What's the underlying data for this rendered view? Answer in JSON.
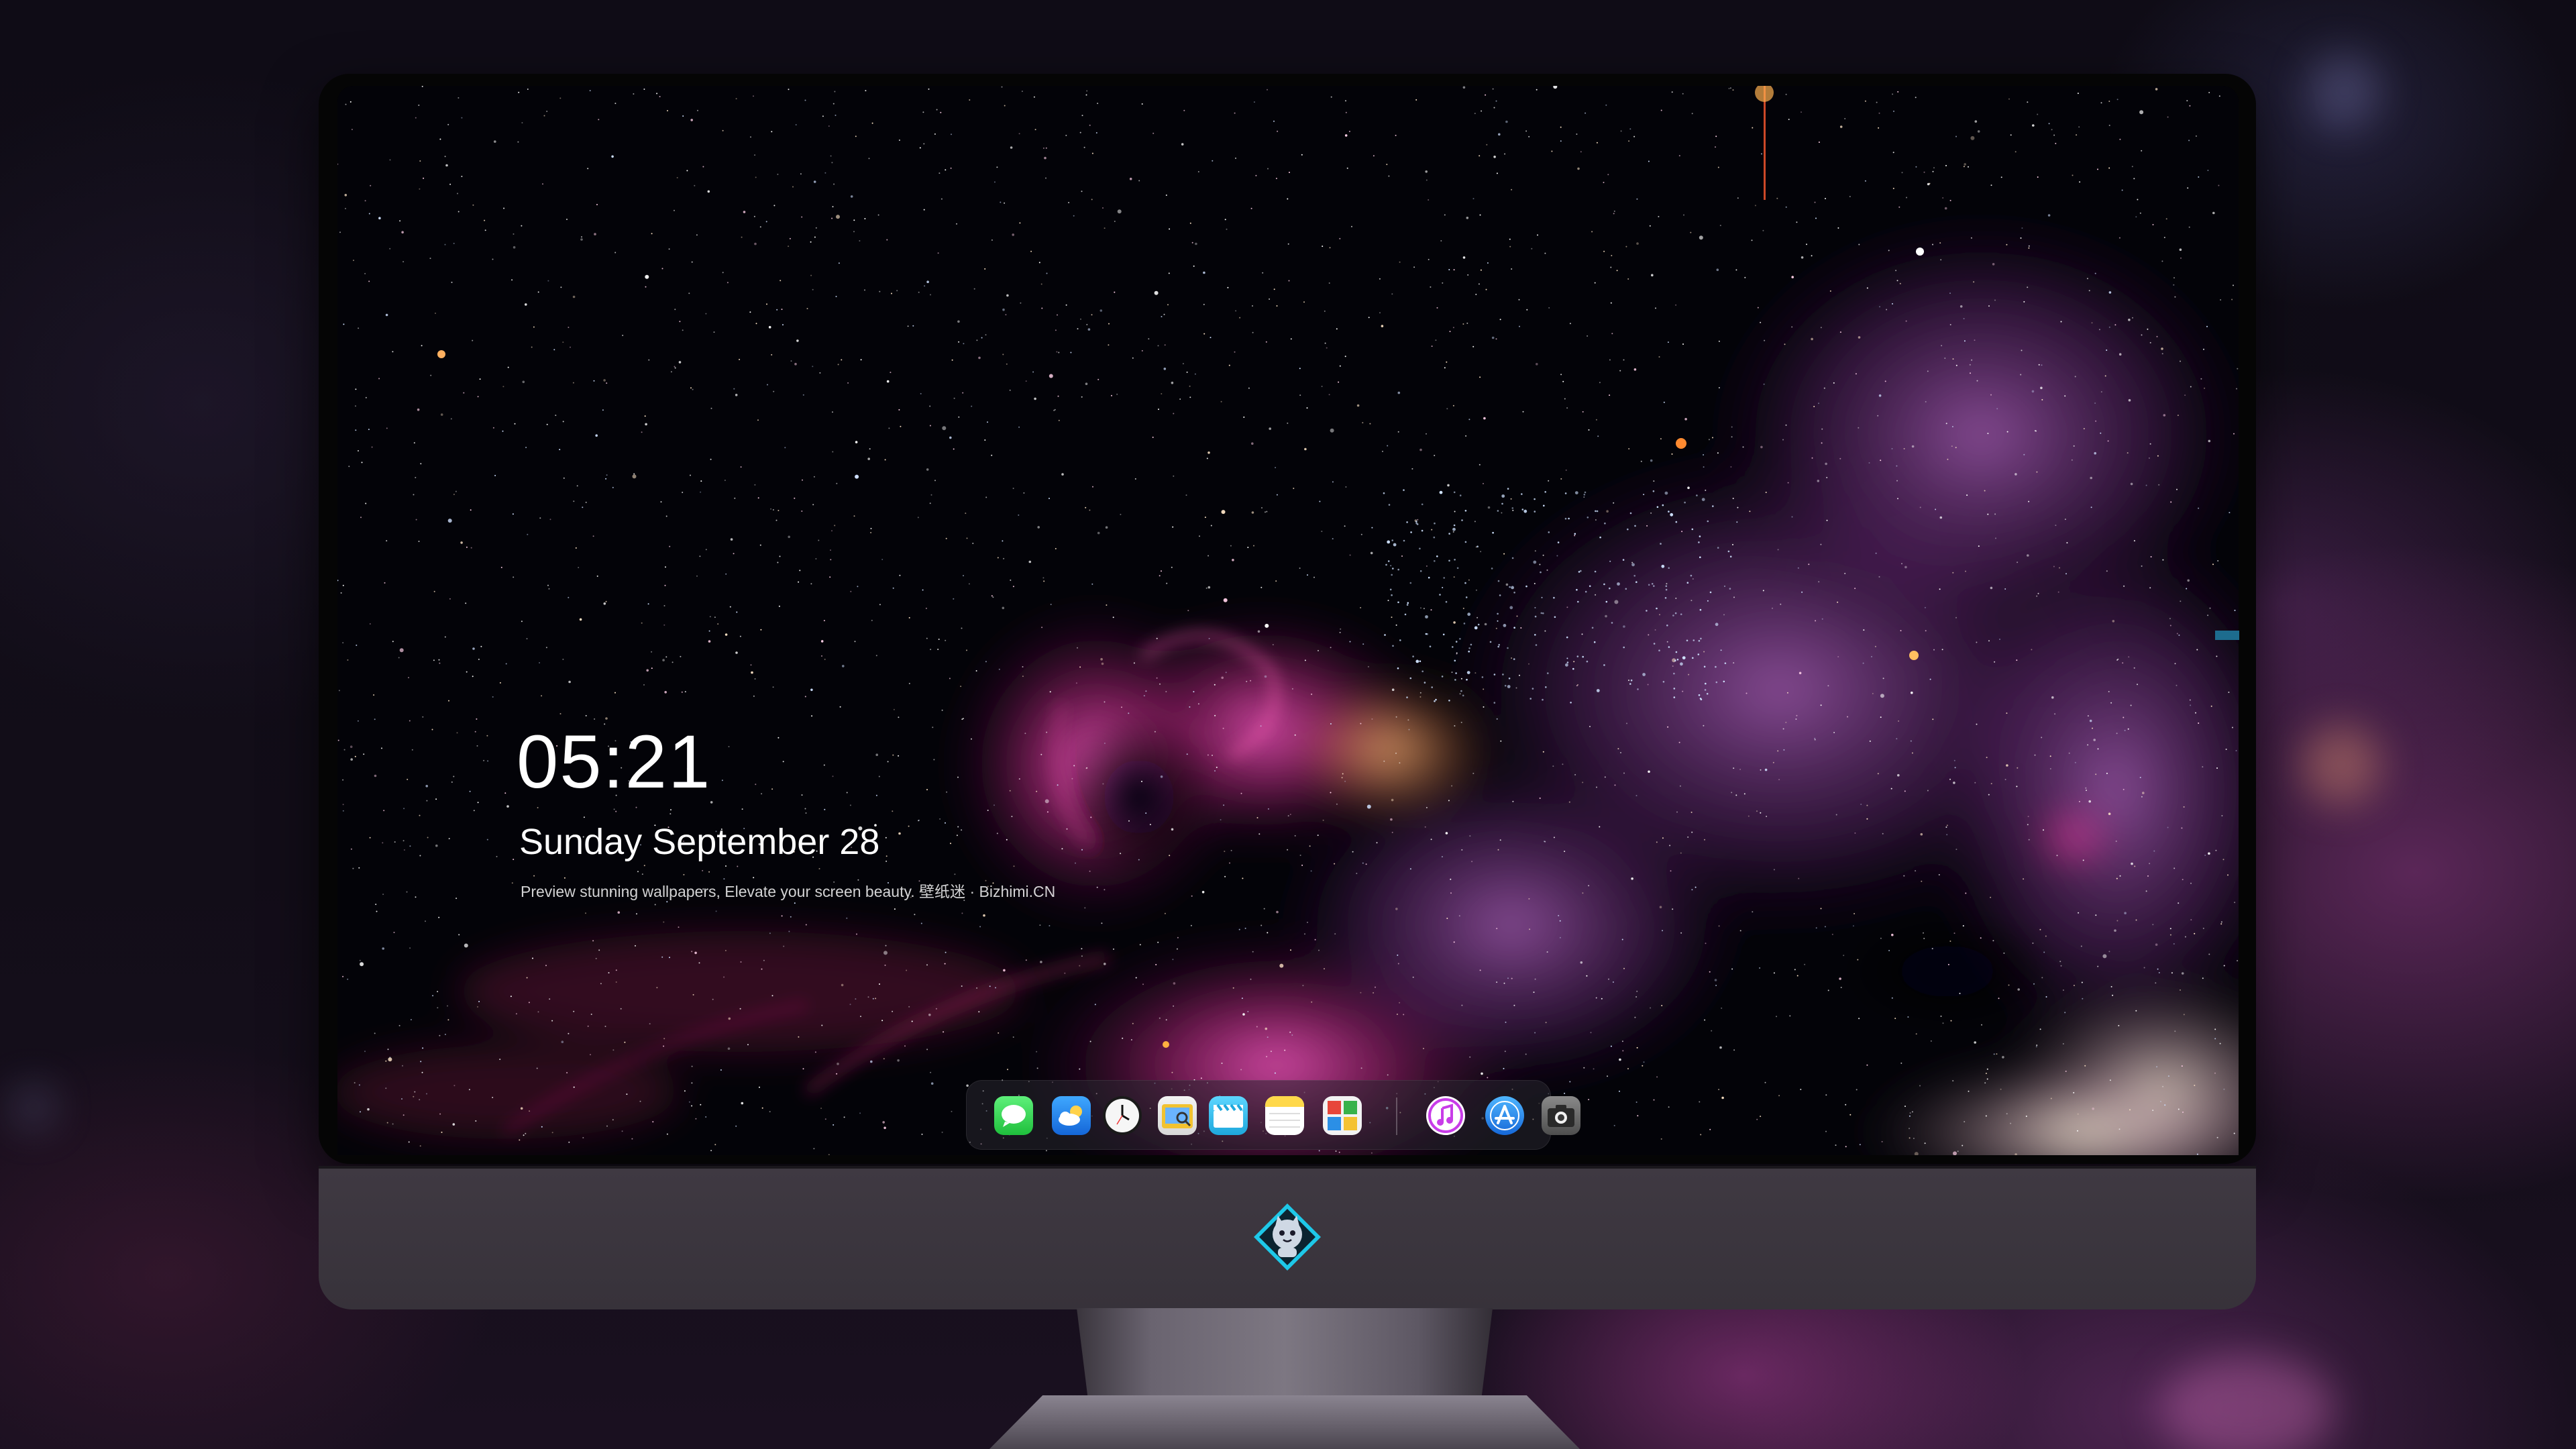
{
  "lock_screen": {
    "time": "05:21",
    "date": "Sunday September  28",
    "tagline": "Preview stunning wallpapers, Elevate your screen beauty. 壁纸迷 · Bizhimi.CN"
  },
  "dock": {
    "apps": [
      {
        "name": "Messages",
        "icon": "messages-icon",
        "color": "#2fcf4a"
      },
      {
        "name": "Weather",
        "icon": "weather-icon",
        "color": "#1e8cf0"
      },
      {
        "name": "Clock",
        "icon": "clock-icon",
        "color": "#f4f4f4"
      },
      {
        "name": "Preview",
        "icon": "preview-icon",
        "color": "#f2c230"
      },
      {
        "name": "Clips",
        "icon": "clips-icon",
        "color": "#2fc2ec"
      },
      {
        "name": "Notes",
        "icon": "notes-icon",
        "color": "#ffd84a"
      },
      {
        "name": "Photo Booth",
        "icon": "photo-booth-icon",
        "color": "#e7463a"
      },
      {
        "name": "Music",
        "icon": "music-icon",
        "color": "#c83ce8"
      },
      {
        "name": "App Store",
        "icon": "app-store-icon",
        "color": "#1f8ff2"
      },
      {
        "name": "Camera",
        "icon": "camera-icon",
        "color": "#6a6a6a"
      }
    ]
  },
  "colors": {
    "nebula_magenta": "#d23aa0",
    "monitor_chin": "#3c363f",
    "dock_bg": "rgba(40,38,48,0.55)"
  }
}
